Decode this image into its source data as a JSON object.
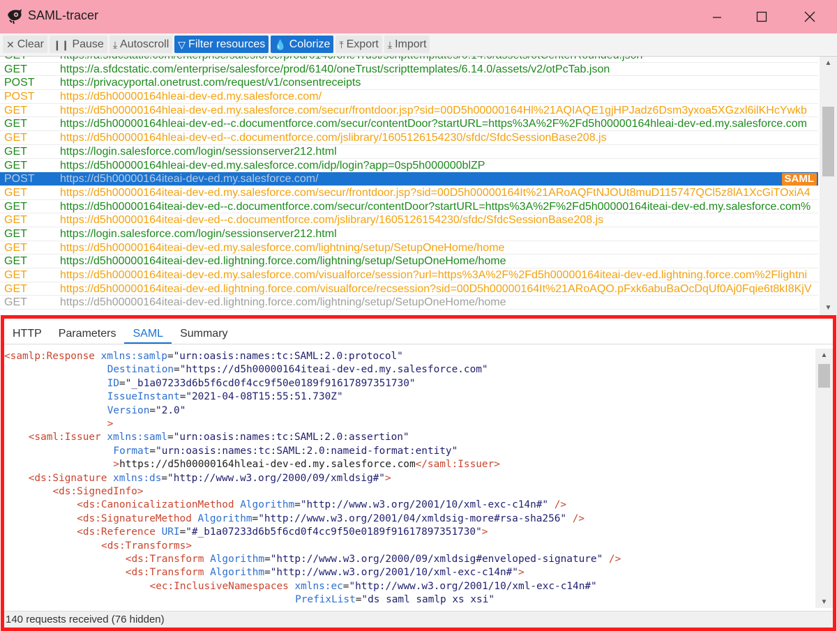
{
  "window": {
    "title": "SAML-tracer",
    "controls": [
      "minimize",
      "maximize",
      "close"
    ]
  },
  "toolbar": {
    "buttons": [
      {
        "label": "Clear",
        "icon": "close-icon",
        "glyph": "✕",
        "active": false
      },
      {
        "label": "Pause",
        "icon": "pause-icon",
        "glyph": "❙❙",
        "active": false
      },
      {
        "label": "Autoscroll",
        "icon": "download-arrow-icon",
        "glyph": "⤓",
        "active": false
      },
      {
        "label": "Filter resources",
        "icon": "filter-icon",
        "glyph": "▽",
        "active": true
      },
      {
        "label": "Colorize",
        "icon": "drop-icon",
        "glyph": "💧",
        "active": true
      },
      {
        "label": "Export",
        "icon": "upload-icon",
        "glyph": "⤒",
        "active": false
      },
      {
        "label": "Import",
        "icon": "import-icon",
        "glyph": "⤓",
        "active": false
      }
    ],
    "active_color": "#1a73d0"
  },
  "requests": [
    {
      "method": "GET",
      "url": "https://a.sfdcstatic.com/enterprise/salesforce/prod/6140/oneTrust/scripttemplates/6.14.0/assets/otCenterRounded.json",
      "color": "green"
    },
    {
      "method": "GET",
      "url": "https://a.sfdcstatic.com/enterprise/salesforce/prod/6140/oneTrust/scripttemplates/6.14.0/assets/v2/otPcTab.json",
      "color": "green"
    },
    {
      "method": "POST",
      "url": "https://privacyportal.onetrust.com/request/v1/consentreceipts",
      "color": "green"
    },
    {
      "method": "POST",
      "url": "https://d5h00000164hleai-dev-ed.my.salesforce.com/",
      "color": "orange"
    },
    {
      "method": "GET",
      "url": "https://d5h00000164hleai-dev-ed.my.salesforce.com/secur/frontdoor.jsp?sid=00D5h00000164Hl%21AQIAQE1gjHPJadz6Dsm3yxoa5XGzxl6ilKHcYwkb",
      "color": "orange"
    },
    {
      "method": "GET",
      "url": "https://d5h00000164hleai-dev-ed--c.documentforce.com/secur/contentDoor?startURL=https%3A%2F%2Fd5h00000164hleai-dev-ed.my.salesforce.com",
      "color": "green"
    },
    {
      "method": "GET",
      "url": "https://d5h00000164hleai-dev-ed--c.documentforce.com/jslibrary/1605126154230/sfdc/SfdcSessionBase208.js",
      "color": "orange"
    },
    {
      "method": "GET",
      "url": "https://login.salesforce.com/login/sessionserver212.html",
      "color": "green"
    },
    {
      "method": "GET",
      "url": "https://d5h00000164hleai-dev-ed.my.salesforce.com/idp/login?app=0sp5h000000blZP",
      "color": "green"
    },
    {
      "method": "POST",
      "url": "https://d5h00000164iteai-dev-ed.my.salesforce.com/",
      "color": "selected",
      "badge": "SAML"
    },
    {
      "method": "GET",
      "url": "https://d5h00000164iteai-dev-ed.my.salesforce.com/secur/frontdoor.jsp?sid=00D5h00000164It%21ARoAQFtNJOUt8muD115747QCl5z8lA1XcGiTOxiA4",
      "color": "orange"
    },
    {
      "method": "GET",
      "url": "https://d5h00000164iteai-dev-ed--c.documentforce.com/secur/contentDoor?startURL=https%3A%2F%2Fd5h00000164iteai-dev-ed.my.salesforce.com%",
      "color": "green"
    },
    {
      "method": "GET",
      "url": "https://d5h00000164iteai-dev-ed--c.documentforce.com/jslibrary/1605126154230/sfdc/SfdcSessionBase208.js",
      "color": "orange"
    },
    {
      "method": "GET",
      "url": "https://login.salesforce.com/login/sessionserver212.html",
      "color": "green"
    },
    {
      "method": "GET",
      "url": "https://d5h00000164iteai-dev-ed.my.salesforce.com/lightning/setup/SetupOneHome/home",
      "color": "orange"
    },
    {
      "method": "GET",
      "url": "https://d5h00000164iteai-dev-ed.lightning.force.com/lightning/setup/SetupOneHome/home",
      "color": "green"
    },
    {
      "method": "GET",
      "url": "https://d5h00000164iteai-dev-ed.my.salesforce.com/visualforce/session?url=https%3A%2F%2Fd5h00000164iteai-dev-ed.lightning.force.com%2Flightni",
      "color": "orange"
    },
    {
      "method": "GET",
      "url": "https://d5h00000164iteai-dev-ed.lightning.force.com/visualforce/recsession?sid=00D5h00000164It%21ARoAQO.pFxk6abuBaOcDqUf0Aj0Fqie6t8kI8KjV",
      "color": "orange"
    },
    {
      "method": "GET",
      "url": "https://d5h00000164iteai-dev-ed.lightning.force.com/lightning/setup/SetupOneHome/home",
      "color": "gray"
    }
  ],
  "tabs": [
    {
      "label": "HTTP",
      "active": false
    },
    {
      "label": "Parameters",
      "active": false
    },
    {
      "label": "SAML",
      "active": true
    },
    {
      "label": "Summary",
      "active": false
    }
  ],
  "xml_lines": [
    {
      "indent": 0,
      "parts": [
        [
          "t",
          "<samlp:Response "
        ],
        [
          "a",
          "xmlns:samlp"
        ],
        [
          "x",
          "="
        ],
        [
          "v",
          "\"urn:oasis:names:tc:SAML:2.0:protocol\""
        ]
      ]
    },
    {
      "indent": 17,
      "parts": [
        [
          "a",
          "Destination"
        ],
        [
          "x",
          "="
        ],
        [
          "v",
          "\"https://d5h00000164iteai-dev-ed.my.salesforce.com\""
        ]
      ]
    },
    {
      "indent": 17,
      "parts": [
        [
          "a",
          "ID"
        ],
        [
          "x",
          "="
        ],
        [
          "v",
          "\"_b1a07233d6b5f6cd0f4cc9f50e0189f91617897351730\""
        ]
      ]
    },
    {
      "indent": 17,
      "parts": [
        [
          "a",
          "IssueInstant"
        ],
        [
          "x",
          "="
        ],
        [
          "v",
          "\"2021-04-08T15:55:51.730Z\""
        ]
      ]
    },
    {
      "indent": 17,
      "parts": [
        [
          "a",
          "Version"
        ],
        [
          "x",
          "="
        ],
        [
          "v",
          "\"2.0\""
        ]
      ]
    },
    {
      "indent": 17,
      "parts": [
        [
          "t",
          ">"
        ]
      ]
    },
    {
      "indent": 4,
      "parts": [
        [
          "t",
          "<saml:Issuer "
        ],
        [
          "a",
          "xmlns:saml"
        ],
        [
          "x",
          "="
        ],
        [
          "v",
          "\"urn:oasis:names:tc:SAML:2.0:assertion\""
        ]
      ]
    },
    {
      "indent": 18,
      "parts": [
        [
          "a",
          "Format"
        ],
        [
          "x",
          "="
        ],
        [
          "v",
          "\"urn:oasis:names:tc:SAML:2.0:nameid-format:entity\""
        ]
      ]
    },
    {
      "indent": 18,
      "parts": [
        [
          "t",
          ">"
        ],
        [
          "x",
          "https://d5h00000164hleai-dev-ed.my.salesforce.com"
        ],
        [
          "t",
          "</saml:Issuer>"
        ]
      ]
    },
    {
      "indent": 4,
      "parts": [
        [
          "t",
          "<ds:Signature "
        ],
        [
          "a",
          "xmlns:ds"
        ],
        [
          "x",
          "="
        ],
        [
          "v",
          "\"http://www.w3.org/2000/09/xmldsig#\""
        ],
        [
          "t",
          ">"
        ]
      ]
    },
    {
      "indent": 8,
      "parts": [
        [
          "t",
          "<ds:SignedInfo>"
        ]
      ]
    },
    {
      "indent": 12,
      "parts": [
        [
          "t",
          "<ds:CanonicalizationMethod "
        ],
        [
          "a",
          "Algorithm"
        ],
        [
          "x",
          "="
        ],
        [
          "v",
          "\"http://www.w3.org/2001/10/xml-exc-c14n#\""
        ],
        [
          "t",
          " />"
        ]
      ]
    },
    {
      "indent": 12,
      "parts": [
        [
          "t",
          "<ds:SignatureMethod "
        ],
        [
          "a",
          "Algorithm"
        ],
        [
          "x",
          "="
        ],
        [
          "v",
          "\"http://www.w3.org/2001/04/xmldsig-more#rsa-sha256\""
        ],
        [
          "t",
          " />"
        ]
      ]
    },
    {
      "indent": 12,
      "parts": [
        [
          "t",
          "<ds:Reference "
        ],
        [
          "a",
          "URI"
        ],
        [
          "x",
          "="
        ],
        [
          "v",
          "\"#_b1a07233d6b5f6cd0f4cc9f50e0189f91617897351730\""
        ],
        [
          "t",
          ">"
        ]
      ]
    },
    {
      "indent": 16,
      "parts": [
        [
          "t",
          "<ds:Transforms>"
        ]
      ]
    },
    {
      "indent": 20,
      "parts": [
        [
          "t",
          "<ds:Transform "
        ],
        [
          "a",
          "Algorithm"
        ],
        [
          "x",
          "="
        ],
        [
          "v",
          "\"http://www.w3.org/2000/09/xmldsig#enveloped-signature\""
        ],
        [
          "t",
          " />"
        ]
      ]
    },
    {
      "indent": 20,
      "parts": [
        [
          "t",
          "<ds:Transform "
        ],
        [
          "a",
          "Algorithm"
        ],
        [
          "x",
          "="
        ],
        [
          "v",
          "\"http://www.w3.org/2001/10/xml-exc-c14n#\""
        ],
        [
          "t",
          ">"
        ]
      ]
    },
    {
      "indent": 24,
      "parts": [
        [
          "t",
          "<ec:InclusiveNamespaces "
        ],
        [
          "a",
          "xmlns:ec"
        ],
        [
          "x",
          "="
        ],
        [
          "v",
          "\"http://www.w3.org/2001/10/xml-exc-c14n#\""
        ]
      ]
    },
    {
      "indent": 48,
      "parts": [
        [
          "a",
          "PrefixList"
        ],
        [
          "x",
          "="
        ],
        [
          "v",
          "\"ds saml samlp xs xsi\""
        ]
      ]
    },
    {
      "indent": 48,
      "parts": [
        [
          "t",
          "/>"
        ]
      ]
    }
  ],
  "status": {
    "text": "140 requests received (76 hidden)"
  },
  "colors": {
    "titlebar": "#f7a3b4",
    "get_ok": "#1e8a1e",
    "redirect": "#f3a20f",
    "pending": "#a0a0a0",
    "selected": "#1a73d0",
    "saml_badge": "#f58a1f",
    "highlight_frame": "#ff1a1a"
  }
}
